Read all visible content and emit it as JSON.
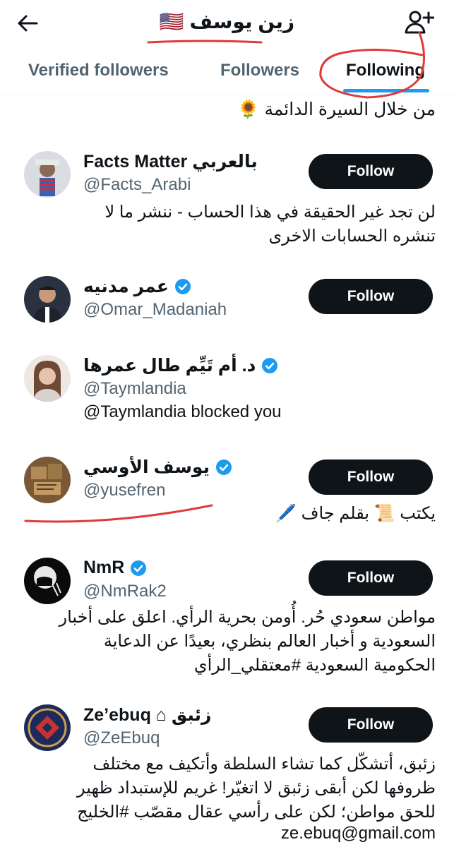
{
  "header": {
    "title": "زين يوسف 🇺🇸",
    "back_icon": "arrow-left-icon",
    "add_icon": "add-user-icon"
  },
  "tabs": [
    {
      "label": "Verified followers",
      "active": false
    },
    {
      "label": "Followers",
      "active": false
    },
    {
      "label": "Following",
      "active": true
    }
  ],
  "snippet": "من خلال السيرة الدائمة 🌻",
  "users": [
    {
      "name": "Facts Matter بالعربي",
      "handle": "@Facts_Arabi",
      "verified": false,
      "button": "Follow",
      "bio": [
        "لن تجد غير الحقيقة في هذا الحساب - ننشر ما لا",
        "تنشره الحسابات الاخرى"
      ]
    },
    {
      "name": "عمر مدنيه",
      "handle": "@Omar_Madaniah",
      "verified": true,
      "button": "Follow",
      "bio": []
    },
    {
      "name": "د. أم تَيِّم طال عمرها",
      "handle": "@Taymlandia",
      "verified": true,
      "button": "",
      "bio": [
        "@Taymlandia blocked you"
      ]
    },
    {
      "name": "يوسف الأوسي",
      "handle": "@yusefren",
      "verified": true,
      "button": "Follow",
      "bio": [
        "يكتب 📜 بقلم جاف 🖊️"
      ]
    },
    {
      "name": "NmR",
      "handle": "@NmRak2",
      "verified": true,
      "button": "Follow",
      "bio": [
        "مواطن سعودي حُر. أُومن بحرية الرأي. اعلق على أخبار",
        "السعودية و أخبار العالم بنظري، بعيدًا عن الدعاية",
        "الحكومية السعودية #معتقلي_الرأي"
      ]
    },
    {
      "name": "Ze’ebuq ⌂ زئبق",
      "handle": "@ZeEbuq",
      "verified": false,
      "button": "Follow",
      "bio": [
        "زئبق، أتشكّل كما تشاء السلطة وأتكيف مع مختلف",
        "ظروفها لكن أبقى زئبق لا اتغيّر! غريم للإستبداد ظهير",
        "للحق مواطن؛ لكن على رأسي عقال مقصّب #الخليج",
        "ze.ebuq@gmail.com"
      ]
    }
  ],
  "colors": {
    "accent": "#1d9bf0",
    "button": "#0f1419",
    "annotation": "#e03a3a"
  }
}
